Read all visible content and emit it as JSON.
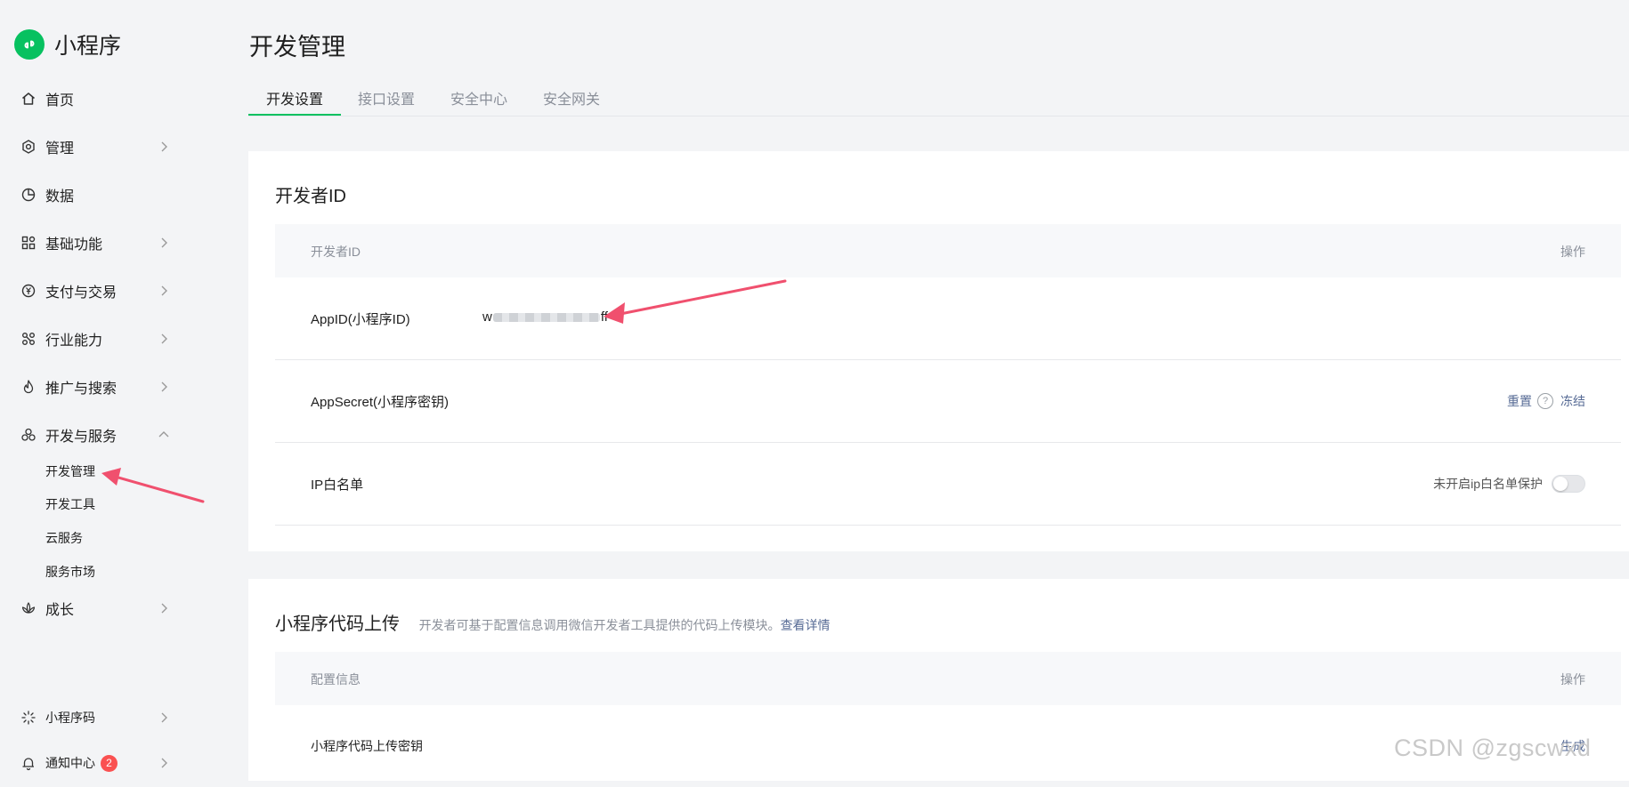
{
  "brand": {
    "name": "小程序",
    "logo": "mini-program-logo",
    "color": "#07c160"
  },
  "sidebar": {
    "items": [
      {
        "label": "首页",
        "icon": "home-icon"
      },
      {
        "label": "管理",
        "icon": "settings-icon"
      },
      {
        "label": "数据",
        "icon": "pie-chart-icon"
      },
      {
        "label": "基础功能",
        "icon": "grid-icon"
      },
      {
        "label": "支付与交易",
        "icon": "yen-icon"
      },
      {
        "label": "行业能力",
        "icon": "network-icon"
      },
      {
        "label": "推广与搜索",
        "icon": "flame-icon"
      },
      {
        "label": "开发与服务",
        "icon": "cluster-icon",
        "expanded": true
      },
      {
        "label": "成长",
        "icon": "lotus-icon"
      }
    ],
    "sub_items": [
      "开发管理",
      "开发工具",
      "云服务",
      "服务市场"
    ],
    "bottom": {
      "qrcode_label": "小程序码",
      "notify_label": "通知中心",
      "notify_count": "2"
    }
  },
  "page": {
    "title": "开发管理"
  },
  "tabs": [
    "开发设置",
    "接口设置",
    "安全中心",
    "安全网关"
  ],
  "developer_id": {
    "title": "开发者ID",
    "header_left": "开发者ID",
    "header_right": "操作",
    "appid_label": "AppID(小程序ID)",
    "appid_prefix": "w",
    "appid_suffix": "ff",
    "secret_label": "AppSecret(小程序密钥)",
    "reset_label": "重置",
    "freeze_label": "冻结",
    "ip_label": "IP白名单",
    "ip_toggle_label": "未开启ip白名单保护",
    "ip_toggle_on": false
  },
  "code_upload": {
    "title": "小程序代码上传",
    "desc": "开发者可基于配置信息调用微信开发者工具提供的代码上传模块。",
    "link": "查看详情",
    "header_left": "配置信息",
    "header_right": "操作",
    "key_label": "小程序代码上传密钥",
    "generate_label": "生成"
  },
  "watermark": "CSDN @zgscwxd",
  "colors": {
    "accent": "#07c160",
    "link": "#576b95",
    "arrow": "#f0506e",
    "badge": "#fa5151"
  }
}
